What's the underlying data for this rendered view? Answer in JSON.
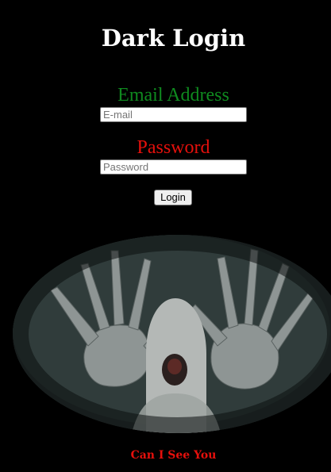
{
  "header": {
    "title": "Dark Login"
  },
  "form": {
    "email_label": "Email Address",
    "email_placeholder": "E-mail",
    "email_value": "",
    "password_label": "Password",
    "password_placeholder": "Password",
    "password_value": "",
    "login_label": "Login"
  },
  "image": {
    "subject": "pale-creature-hands-raised",
    "caption": "Can I See You"
  },
  "colors": {
    "background": "#000000",
    "title": "#ffffff",
    "email_label": "#0f8a1f",
    "password_label": "#e5100c",
    "caption": "#e5100c"
  }
}
